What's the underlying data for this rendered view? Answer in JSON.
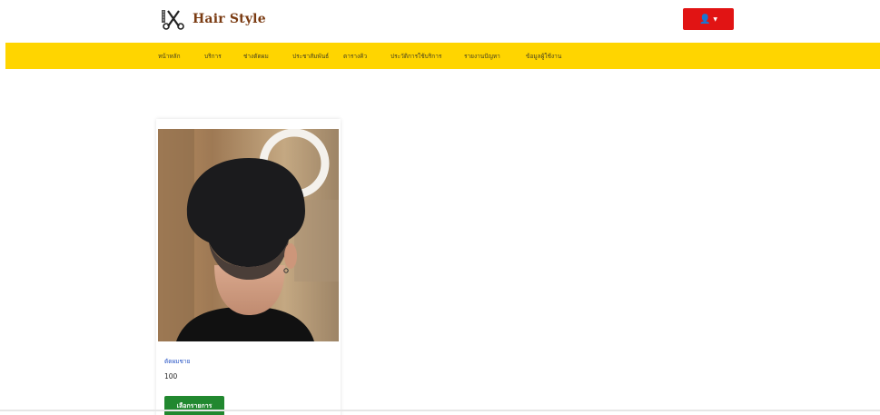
{
  "header": {
    "brand": "Hair Style",
    "logo_icon": "scissors-comb-icon",
    "user_menu": {
      "icon": "user-icon",
      "caret_icon": "chevron-down-icon",
      "color": "#e11414"
    }
  },
  "nav": {
    "color": "#ffd500",
    "items": [
      "หน้าหลัก",
      "บริการ",
      "ช่างตัดผม",
      "ประชาสัมพันธ์",
      "ตารางคิว",
      "ประวัติการใช้บริการ",
      "รายงานปัญหา",
      "ข้อมูลผู้ใช้งาน"
    ]
  },
  "service_card": {
    "name": "ตัดผมชาย",
    "price": "100",
    "select_label": "เลือกรายการ",
    "button_color": "#21882f"
  }
}
